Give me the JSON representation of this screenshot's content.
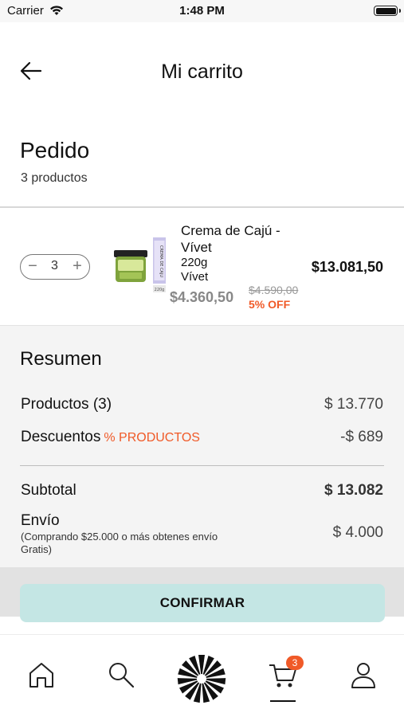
{
  "status_bar": {
    "carrier": "Carrier",
    "time": "1:48 PM"
  },
  "header": {
    "title": "Mi carrito"
  },
  "order": {
    "title": "Pedido",
    "count": "3 productos"
  },
  "product": {
    "quantity": "3",
    "name": "Crema de Cajú - Vívet",
    "weight": "220g",
    "brand": "Vívet",
    "unit_price": "$4.360,50",
    "old_price": "$4.590,00",
    "discount": "5% OFF",
    "total": "$13.081,50",
    "image_label": "CREMA DE CAJU"
  },
  "summary": {
    "title": "Resumen",
    "products_label": "Productos (3)",
    "products_value": "$ 13.770",
    "discounts_label": "Descuentos",
    "discounts_tag": "% PRODUCTOS",
    "discounts_value": "-$ 689",
    "subtotal_label": "Subtotal",
    "subtotal_value": "$ 13.082",
    "shipping_label": "Envío",
    "shipping_note": "(Comprando $25.000 o más obtenes envío Gratis)",
    "shipping_value": "$ 4.000"
  },
  "confirm_label": "CONFIRMAR",
  "tabbar": {
    "items": [
      {
        "icon": "home-icon"
      },
      {
        "icon": "search-icon"
      },
      {
        "icon": "brand-logo-icon"
      },
      {
        "icon": "cart-icon",
        "badge": "3",
        "active": true
      },
      {
        "icon": "profile-icon"
      }
    ]
  },
  "colors": {
    "accent": "#f05a28",
    "confirm_bg": "#c4e6e4",
    "summary_bg": "#f4f4f4"
  }
}
